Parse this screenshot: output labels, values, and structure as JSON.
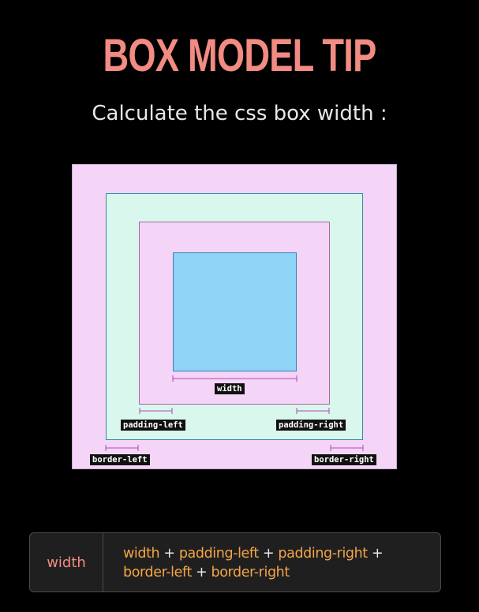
{
  "header": {
    "title": "BOX MODEL TIP",
    "subtitle": "Calculate the css box width :"
  },
  "diagram": {
    "labels": {
      "width": "width",
      "padding_left": "padding-left",
      "padding_right": "padding-right",
      "border_left": "border-left",
      "border_right": "border-right"
    }
  },
  "formula": {
    "label": "width",
    "line1": [
      {
        "type": "term",
        "text": "width"
      },
      {
        "type": "op",
        "text": " + "
      },
      {
        "type": "term",
        "text": "padding-left"
      },
      {
        "type": "op",
        "text": " + "
      },
      {
        "type": "term",
        "text": "padding-right"
      },
      {
        "type": "op",
        "text": " +"
      }
    ],
    "line2": [
      {
        "type": "term",
        "text": "border-left"
      },
      {
        "type": "op",
        "text": " + "
      },
      {
        "type": "term",
        "text": "border-right"
      }
    ]
  },
  "colors": {
    "title": "#f28b82",
    "term": "#f5a547",
    "margin_fill": "#f4d4f7",
    "border_fill": "#d9f7ec",
    "content_fill": "#8fd3f7"
  }
}
